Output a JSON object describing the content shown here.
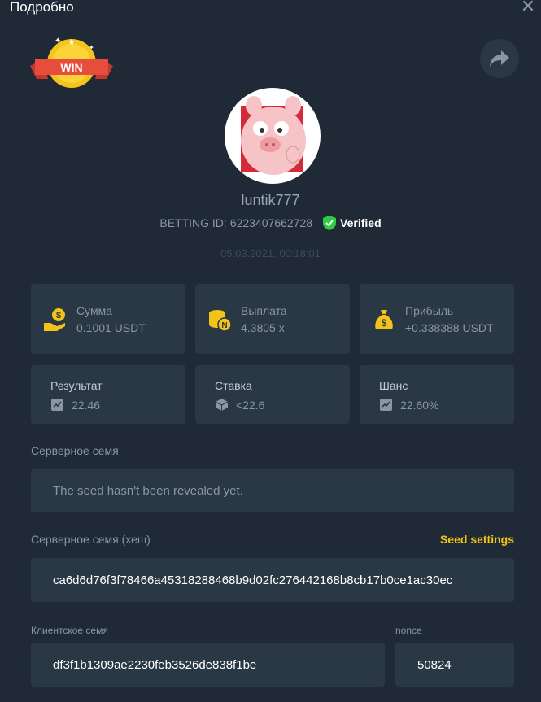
{
  "header": {
    "title": "Подробно"
  },
  "badge": {
    "text": "WIN"
  },
  "user": {
    "username": "luntik777",
    "betting_id_label": "BETTING ID:",
    "betting_id": "6223407662728",
    "verified_label": "Verified",
    "date": "05.03.2021, 00:18:01"
  },
  "stats": [
    {
      "label": "Сумма",
      "value": "0.1001 USDT",
      "icon": "money-hand-icon"
    },
    {
      "label": "Выплата",
      "value": "4.3805 x",
      "icon": "coins-stack-icon"
    },
    {
      "label": "Прибыль",
      "value": "+0.338388 USDT",
      "icon": "money-bag-icon"
    }
  ],
  "results": [
    {
      "label": "Результат",
      "value": "22.46",
      "icon": "result-icon"
    },
    {
      "label": "Ставка",
      "value": "<22.6",
      "icon": "dice-icon"
    },
    {
      "label": "Шанс",
      "value": "22.60%",
      "icon": "chance-icon"
    }
  ],
  "server_seed": {
    "label": "Серверное семя",
    "value": "The seed hasn't been revealed yet."
  },
  "server_seed_hash": {
    "label": "Серверное семя (хеш)",
    "settings_link": "Seed settings",
    "value": "ca6d6d76f3f78466a45318288468b9d02fc276442168b8cb17b0ce1ac30ec"
  },
  "client_seed": {
    "label": "Клиентское семя",
    "value": "df3f1b1309ae2230feb3526de838f1be"
  },
  "nonce": {
    "label": "nonce",
    "value": "50824"
  },
  "colors": {
    "background": "#1f2a36",
    "card": "#2a3745",
    "accent_yellow": "#f2c417",
    "verified_green": "#2ecc40"
  }
}
